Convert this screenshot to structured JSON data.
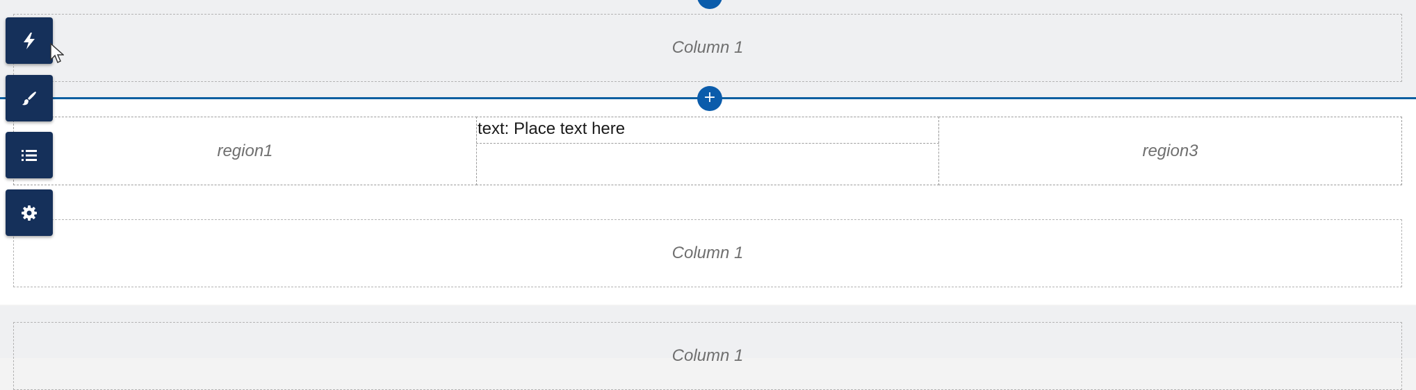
{
  "sections": [
    {
      "column_label": "Column 1"
    },
    {
      "regions": [
        {
          "label": "region1"
        },
        {
          "text_component": "text: Place text here"
        },
        {
          "label": "region3"
        }
      ]
    },
    {
      "column_label": "Column 1"
    },
    {
      "column_label": "Column 1"
    }
  ],
  "add_button_glyph": "+",
  "toolbar": {
    "items": [
      {
        "icon": "lightning-icon"
      },
      {
        "icon": "brush-icon"
      },
      {
        "icon": "list-icon"
      },
      {
        "icon": "gear-icon"
      }
    ]
  },
  "colors": {
    "toolbar_bg": "#15305a",
    "accent": "#0b5cab",
    "selection_line": "#0a5fa0"
  }
}
